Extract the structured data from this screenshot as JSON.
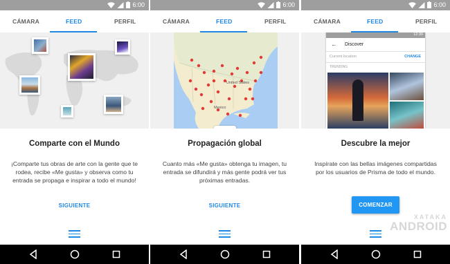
{
  "status": {
    "time": "6:00"
  },
  "tabs": {
    "camera": "CÁMARA",
    "feed": "FEED",
    "profile": "PERFIL"
  },
  "panels": [
    {
      "title": "Comparte con el Mundo",
      "body": "¡Comparte tus obras de arte con la gente que te rodea, recibe «Me gusta» y observa como tu entrada se propaga e inspirar a todo el mundo!",
      "action": "SIGUIENTE"
    },
    {
      "title": "Propagación global",
      "body": "Cuanto más «Me gusta» obtenga tu imagen, tu entrada se difundirá y más gente podrá ver tus próximas entradas.",
      "action": "SIGUIENTE",
      "map_labels": {
        "states": "United States",
        "mexico": "Mexico"
      }
    },
    {
      "title": "Descubre la mejor",
      "body": "Inspírate con las bellas imágenes compartidas por los usuarios de Prisma de todo el mundo.",
      "action": "COMENZAR",
      "phone": {
        "time": "12:30",
        "header": "Discover",
        "location": "Current location",
        "change": "CHANGE",
        "trending": "TRENDING"
      }
    }
  ],
  "watermark": {
    "top": "XATAKA",
    "bottom": "ANDROID"
  },
  "colors": {
    "accent": "#1e88e5",
    "button": "#2196f3",
    "statusbar": "#9e9e9e"
  }
}
